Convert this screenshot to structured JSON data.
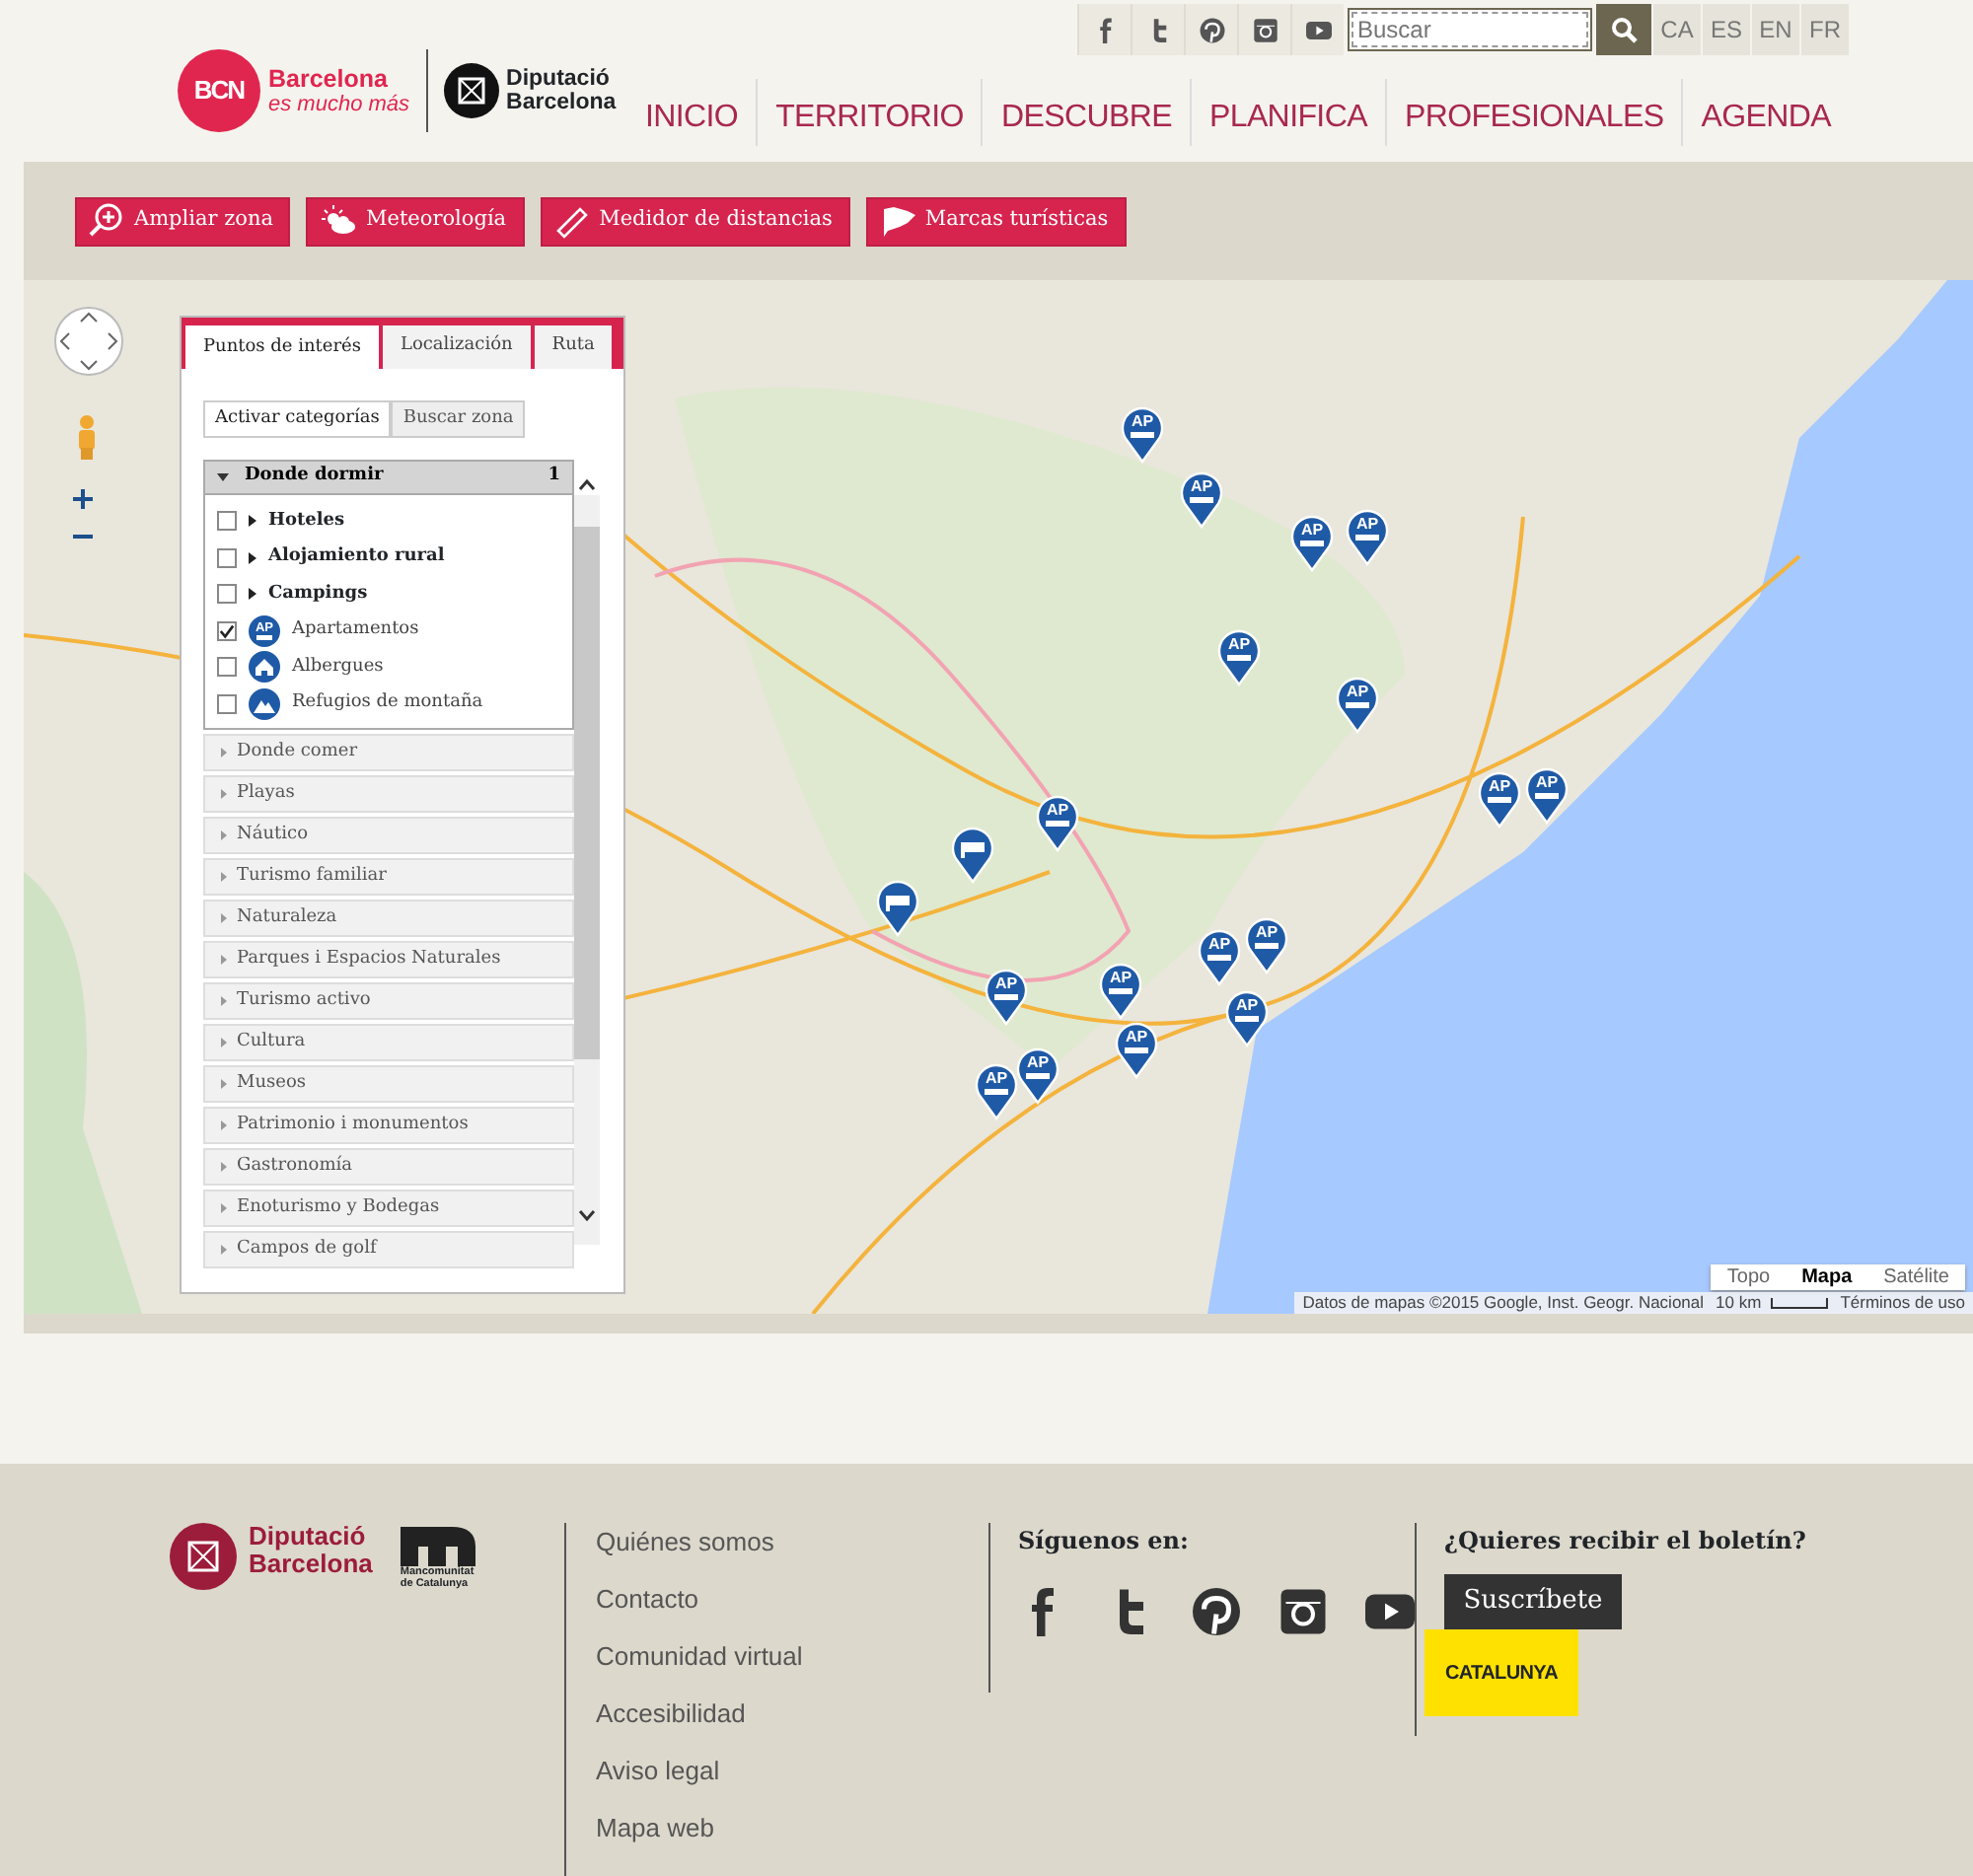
{
  "header": {
    "brand": {
      "badge": "BCN",
      "name": "Barcelona",
      "tagline": "es mucho más"
    },
    "partner": {
      "line_1": "Diputació",
      "line_2": "Barcelona"
    },
    "social": [
      {
        "kind": "facebook"
      },
      {
        "kind": "twitter"
      },
      {
        "kind": "pinterest"
      },
      {
        "kind": "instagram"
      },
      {
        "kind": "youtube"
      }
    ],
    "search": {
      "placeholder": "Buscar"
    },
    "languages": [
      "CA",
      "ES",
      "EN",
      "FR"
    ],
    "nav": [
      "INICIO",
      "TERRITORIO",
      "DESCUBRE",
      "PLANIFICA",
      "PROFESIONALES",
      "AGENDA"
    ]
  },
  "toolbar": [
    {
      "kind": "zoom",
      "label": "Ampliar zona"
    },
    {
      "kind": "weather",
      "label": "Meteorología"
    },
    {
      "kind": "ruler",
      "label": "Medidor de distancias"
    },
    {
      "kind": "flag",
      "label": "Marcas turísticas"
    }
  ],
  "panel": {
    "tabs": [
      {
        "label": "Puntos de interés",
        "selected": true
      },
      {
        "label": "Localización",
        "selected": false
      },
      {
        "label": "Ruta",
        "selected": false
      }
    ],
    "subtabs": [
      {
        "label": "Activar categorías",
        "selected": true
      },
      {
        "label": "Buscar zona",
        "selected": false
      }
    ],
    "categories": [
      {
        "label": "Donde dormir",
        "expanded": true,
        "count": "1",
        "children": [
          {
            "kind": "group",
            "label": "Hoteles",
            "checked": false
          },
          {
            "kind": "group",
            "label": "Alojamiento rural",
            "checked": false
          },
          {
            "kind": "group",
            "label": "Campings",
            "checked": false
          },
          {
            "kind": "apartment",
            "label": "Apartamentos",
            "icon_text": "AP",
            "checked": true
          },
          {
            "kind": "hostel",
            "label": "Albergues",
            "checked": false
          },
          {
            "kind": "refuge",
            "label": "Refugios de montaña",
            "checked": false
          }
        ]
      },
      {
        "label": "Donde comer",
        "expanded": false
      },
      {
        "label": "Playas",
        "expanded": false
      },
      {
        "label": "Náutico",
        "expanded": false
      },
      {
        "label": "Turismo familiar",
        "expanded": false
      },
      {
        "label": "Naturaleza",
        "expanded": false
      },
      {
        "label": "Parques i Espacios Naturales",
        "expanded": false
      },
      {
        "label": "Turismo activo",
        "expanded": false
      },
      {
        "label": "Cultura",
        "expanded": false
      },
      {
        "label": "Museos",
        "expanded": false
      },
      {
        "label": "Patrimonio i monumentos",
        "expanded": false
      },
      {
        "label": "Gastronomía",
        "expanded": false
      },
      {
        "label": "Enoturismo y Bodegas",
        "expanded": false
      },
      {
        "label": "Campos de golf",
        "expanded": false
      }
    ]
  },
  "map": {
    "markers": [
      {
        "kind": "apartment",
        "label": "AP"
      },
      {
        "kind": "apartment",
        "label": "AP"
      },
      {
        "kind": "apartment",
        "label": "AP"
      },
      {
        "kind": "apartment",
        "label": "AP"
      },
      {
        "kind": "apartment",
        "label": "AP"
      },
      {
        "kind": "apartment",
        "label": "AP"
      },
      {
        "kind": "apartment",
        "label": "AP"
      },
      {
        "kind": "apartment",
        "label": "AP"
      },
      {
        "kind": "apartment",
        "label": "AP"
      },
      {
        "kind": "bed"
      },
      {
        "kind": "bed"
      },
      {
        "kind": "apartment",
        "label": "AP"
      },
      {
        "kind": "apartment",
        "label": "AP"
      },
      {
        "kind": "apartment",
        "label": "AP"
      },
      {
        "kind": "apartment",
        "label": "AP"
      },
      {
        "kind": "apartment",
        "label": "AP"
      },
      {
        "kind": "apartment",
        "label": "AP"
      },
      {
        "kind": "apartment",
        "label": "AP"
      },
      {
        "kind": "apartment",
        "label": "AP"
      }
    ],
    "types": [
      {
        "label": "Topo",
        "selected": false
      },
      {
        "label": "Mapa",
        "selected": true
      },
      {
        "label": "Satélite",
        "selected": false
      }
    ],
    "attribution": "Datos de mapas ©2015 Google, Inst. Geogr. Nacional",
    "scale": "10 km",
    "terms": "Términos de uso"
  },
  "footer": {
    "partner": {
      "line_1": "Diputació",
      "line_2": "Barcelona"
    },
    "mancomunitat": "Mancomunitat de Catalunya",
    "links": [
      "Quiénes somos",
      "Contacto",
      "Comunidad virtual",
      "Accesibilidad",
      "Aviso legal",
      "Mapa web"
    ],
    "social_heading": "Síguenos en:",
    "social": [
      {
        "kind": "facebook"
      },
      {
        "kind": "twitter"
      },
      {
        "kind": "pinterest"
      },
      {
        "kind": "instagram"
      },
      {
        "kind": "youtube"
      }
    ],
    "newsletter_heading": "¿Quieres recibir el boletín?",
    "subscribe": "Suscríbete",
    "catalunya": "CATALUNYA"
  }
}
